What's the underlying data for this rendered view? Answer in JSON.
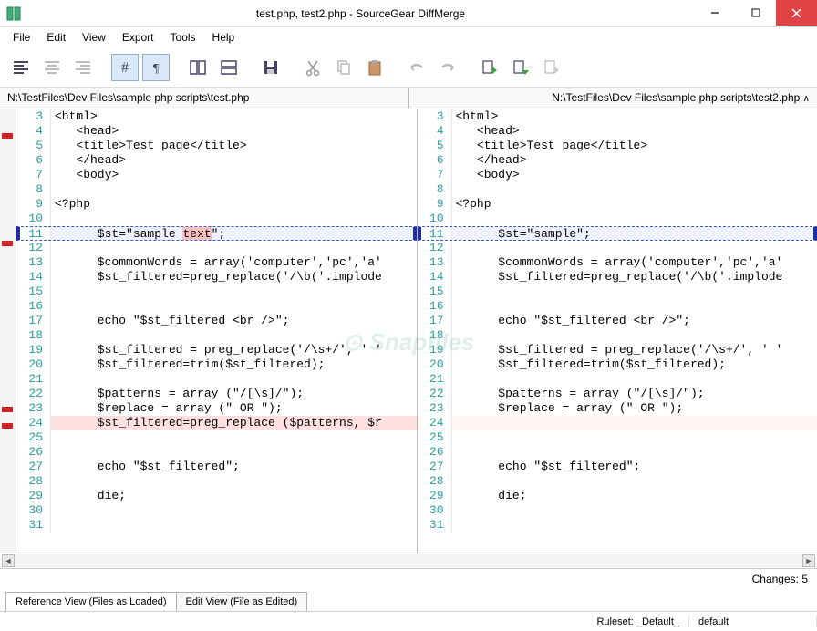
{
  "window": {
    "title": "test.php, test2.php - SourceGear DiffMerge"
  },
  "menu": {
    "items": [
      "File",
      "Edit",
      "View",
      "Export",
      "Tools",
      "Help"
    ]
  },
  "filepaths": {
    "left": "N:\\TestFiles\\Dev Files\\sample php scripts\\test.php",
    "right": "N:\\TestFiles\\Dev Files\\sample php scripts\\test2.php"
  },
  "left_lines": [
    {
      "n": "3",
      "t": "<html>",
      "cls": ""
    },
    {
      "n": "4",
      "t": "   <head>",
      "cls": ""
    },
    {
      "n": "5",
      "t": "   <title>Test page</title>",
      "cls": ""
    },
    {
      "n": "6",
      "t": "   </head>",
      "cls": ""
    },
    {
      "n": "7",
      "t": "   <body>",
      "cls": ""
    },
    {
      "n": "8",
      "t": "",
      "cls": ""
    },
    {
      "n": "9",
      "t": "<?php",
      "cls": ""
    },
    {
      "n": "10",
      "t": "",
      "cls": ""
    },
    {
      "n": "11",
      "t": "      $st=\"sample text\";",
      "cls": "line-changed",
      "diffword": "text"
    },
    {
      "n": "12",
      "t": "",
      "cls": ""
    },
    {
      "n": "13",
      "t": "      $commonWords = array('computer','pc','a'",
      "cls": ""
    },
    {
      "n": "14",
      "t": "      $st_filtered=preg_replace('/\\b('.implode",
      "cls": ""
    },
    {
      "n": "15",
      "t": "",
      "cls": ""
    },
    {
      "n": "16",
      "t": "",
      "cls": ""
    },
    {
      "n": "17",
      "t": "      echo \"$st_filtered <br />\";",
      "cls": ""
    },
    {
      "n": "18",
      "t": "",
      "cls": ""
    },
    {
      "n": "19",
      "t": "      $st_filtered = preg_replace('/\\s+/', ' '",
      "cls": ""
    },
    {
      "n": "20",
      "t": "      $st_filtered=trim($st_filtered);",
      "cls": ""
    },
    {
      "n": "21",
      "t": "",
      "cls": ""
    },
    {
      "n": "22",
      "t": "      $patterns = array (\"/[\\s]/\");",
      "cls": ""
    },
    {
      "n": "23",
      "t": "      $replace = array (\" OR \");",
      "cls": ""
    },
    {
      "n": "24",
      "t": "      $st_filtered=preg_replace ($patterns, $r",
      "cls": "line-removed"
    },
    {
      "n": "25",
      "t": "",
      "cls": ""
    },
    {
      "n": "26",
      "t": "",
      "cls": ""
    },
    {
      "n": "27",
      "t": "      echo \"$st_filtered\";",
      "cls": ""
    },
    {
      "n": "28",
      "t": "",
      "cls": ""
    },
    {
      "n": "29",
      "t": "      die;",
      "cls": ""
    },
    {
      "n": "30",
      "t": "",
      "cls": ""
    },
    {
      "n": "31",
      "t": "",
      "cls": ""
    }
  ],
  "right_lines": [
    {
      "n": "3",
      "t": "<html>",
      "cls": ""
    },
    {
      "n": "4",
      "t": "   <head>",
      "cls": ""
    },
    {
      "n": "5",
      "t": "   <title>Test page</title>",
      "cls": ""
    },
    {
      "n": "6",
      "t": "   </head>",
      "cls": ""
    },
    {
      "n": "7",
      "t": "   <body>",
      "cls": ""
    },
    {
      "n": "8",
      "t": "",
      "cls": ""
    },
    {
      "n": "9",
      "t": "<?php",
      "cls": ""
    },
    {
      "n": "10",
      "t": "",
      "cls": ""
    },
    {
      "n": "11",
      "t": "      $st=\"sample\";",
      "cls": "line-changed"
    },
    {
      "n": "12",
      "t": "",
      "cls": ""
    },
    {
      "n": "13",
      "t": "      $commonWords = array('computer','pc','a'",
      "cls": ""
    },
    {
      "n": "14",
      "t": "      $st_filtered=preg_replace('/\\b('.implode",
      "cls": ""
    },
    {
      "n": "15",
      "t": "",
      "cls": ""
    },
    {
      "n": "16",
      "t": "",
      "cls": ""
    },
    {
      "n": "17",
      "t": "      echo \"$st_filtered <br />\";",
      "cls": ""
    },
    {
      "n": "18",
      "t": "",
      "cls": ""
    },
    {
      "n": "19",
      "t": "      $st_filtered = preg_replace('/\\s+/', ' '",
      "cls": ""
    },
    {
      "n": "20",
      "t": "      $st_filtered=trim($st_filtered);",
      "cls": ""
    },
    {
      "n": "21",
      "t": "",
      "cls": ""
    },
    {
      "n": "22",
      "t": "      $patterns = array (\"/[\\s]/\");",
      "cls": ""
    },
    {
      "n": "23",
      "t": "      $replace = array (\" OR \");",
      "cls": ""
    },
    {
      "n": "24",
      "t": "",
      "cls": "line-removed-empty"
    },
    {
      "n": "25",
      "t": "",
      "cls": ""
    },
    {
      "n": "26",
      "t": "",
      "cls": ""
    },
    {
      "n": "27",
      "t": "      echo \"$st_filtered\";",
      "cls": ""
    },
    {
      "n": "28",
      "t": "",
      "cls": ""
    },
    {
      "n": "29",
      "t": "      die;",
      "cls": ""
    },
    {
      "n": "30",
      "t": "",
      "cls": ""
    },
    {
      "n": "31",
      "t": "",
      "cls": ""
    }
  ],
  "change_marks": [
    26,
    144,
    326,
    344
  ],
  "changes_label": "Changes: 5",
  "tabs": {
    "reference": "Reference View (Files as Loaded)",
    "edit": "Edit View (File as Edited)"
  },
  "status": {
    "ruleset_label": "Ruleset:",
    "ruleset_value": "_Default_",
    "encoding": "default"
  },
  "watermark": "⊙ Snapfiles"
}
